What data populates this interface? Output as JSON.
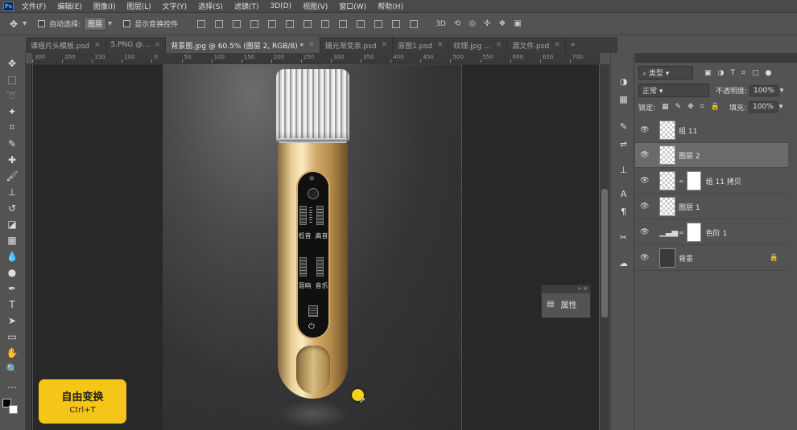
{
  "menu": {
    "ps": "Ps",
    "items": [
      "文件(F)",
      "编辑(E)",
      "图像(I)",
      "图层(L)",
      "文字(Y)",
      "选择(S)",
      "滤镜(T)",
      "3D(D)",
      "视图(V)",
      "窗口(W)",
      "帮助(H)"
    ]
  },
  "options": {
    "auto_select": "自动选择:",
    "auto_select_value": "图层",
    "show_transform": "显示变换控件"
  },
  "tabs": [
    {
      "label": "课程片头模板.psd",
      "active": false
    },
    {
      "label": "5.PNG @...",
      "active": false
    },
    {
      "label": "背景图.jpg @ 60.5% (图层 2, RGB/8) *",
      "active": true
    },
    {
      "label": "铺光渐变亲.psd",
      "active": false
    },
    {
      "label": "原图1.psd",
      "active": false
    },
    {
      "label": "纹理.jpg ...",
      "active": false
    },
    {
      "label": "源文件.psd",
      "active": false
    }
  ],
  "ruler": {
    "labels": [
      "300",
      "200",
      "150",
      "100",
      "0",
      "50",
      "100",
      "150",
      "200",
      "250",
      "300",
      "350",
      "400",
      "450",
      "500",
      "550",
      "600",
      "650",
      "700"
    ]
  },
  "panel": {
    "text": {
      "low": "低音",
      "high": "高音",
      "echo": "混响",
      "music": "音乐"
    }
  },
  "tip": {
    "title": "自由变换",
    "shortcut": "Ctrl+T"
  },
  "properties": {
    "label": "属性"
  },
  "layers": {
    "filter_label": "类型",
    "blend_mode": "正常",
    "opacity_label": "不透明度:",
    "opacity_value": "100%",
    "lock_label": "锁定:",
    "fill_label": "填充:",
    "fill_value": "100%",
    "items": [
      {
        "name": "组 11",
        "selected": false,
        "type": "group"
      },
      {
        "name": "图层 2",
        "selected": true,
        "type": "layer"
      },
      {
        "name": "组 11 拷贝",
        "selected": false,
        "type": "masked"
      },
      {
        "name": "图层 1",
        "selected": false,
        "type": "layer"
      },
      {
        "name": "色阶 1",
        "selected": false,
        "type": "adjust"
      },
      {
        "name": "背景",
        "selected": false,
        "type": "background"
      }
    ]
  },
  "colors": {
    "accent": "#f5c518",
    "gold": "#d9b878",
    "selected_row": "#6b6b6b"
  }
}
